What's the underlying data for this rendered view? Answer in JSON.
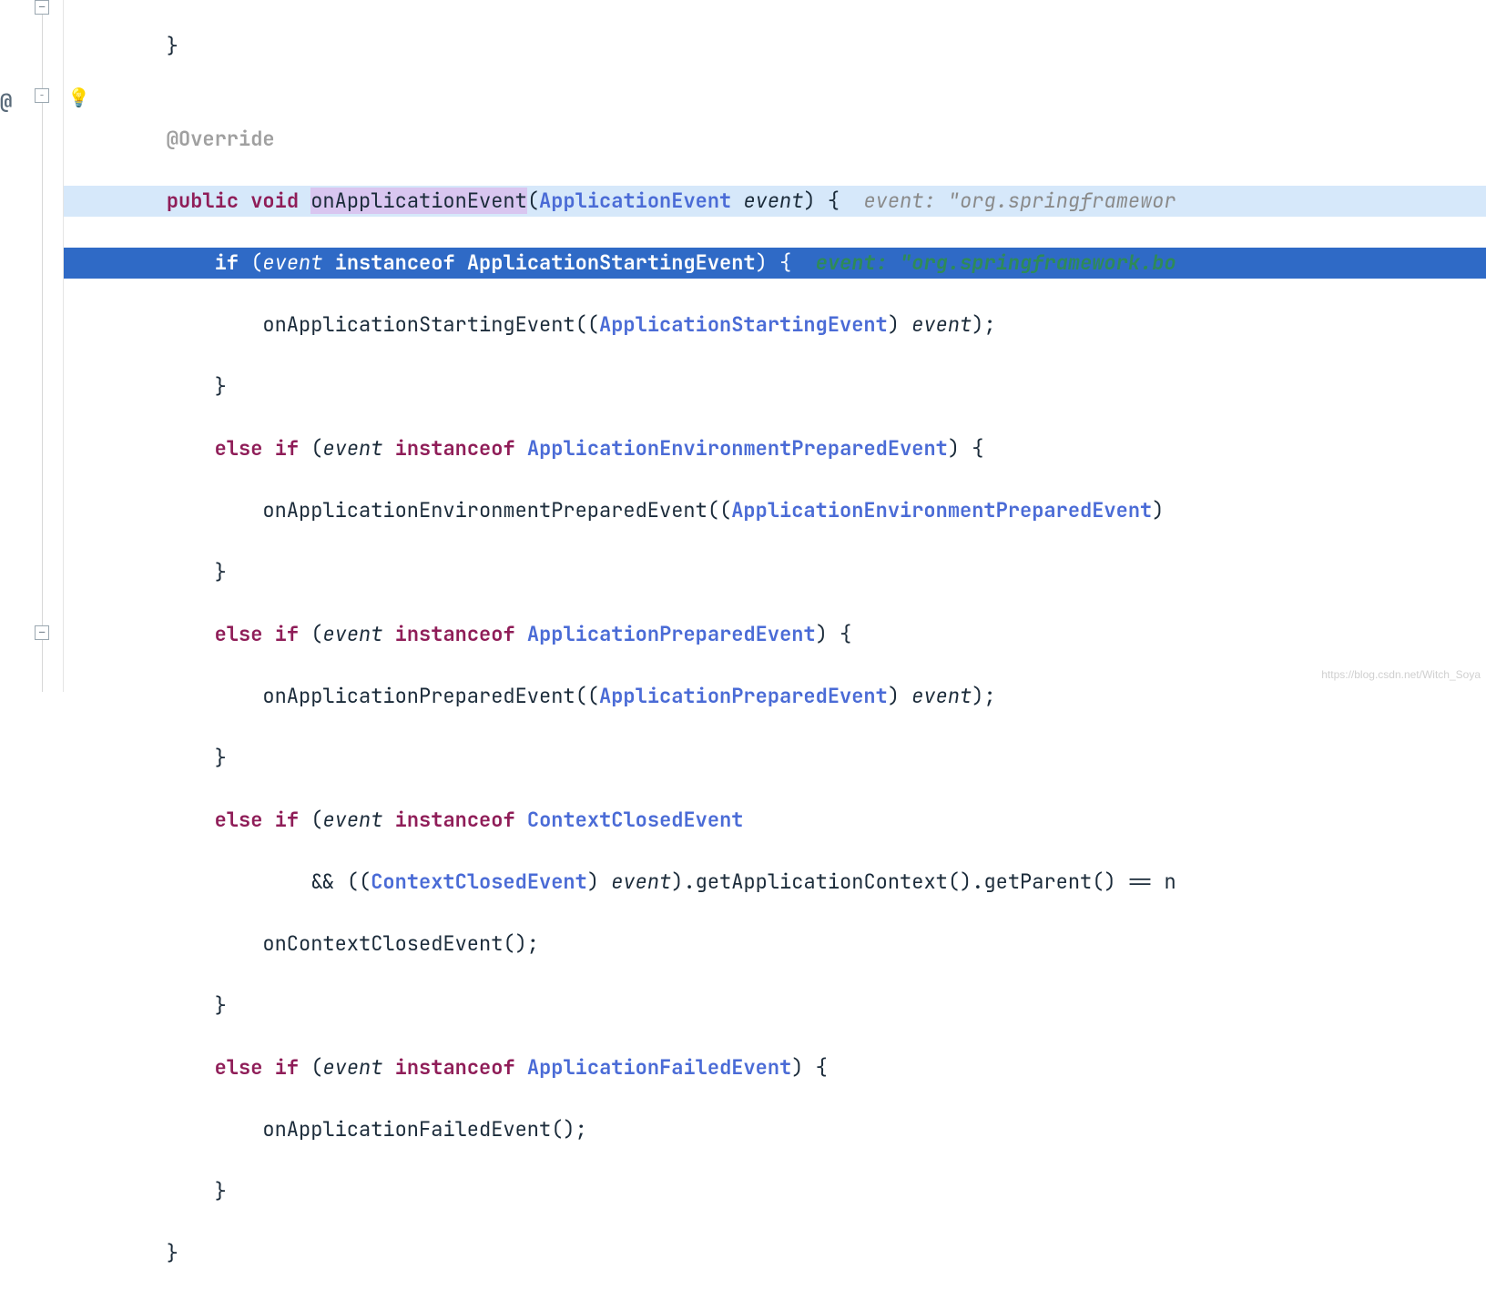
{
  "watermark": "https://blog.csdn.net/Witch_Soya",
  "gutter": {
    "at_marker": "@",
    "bulb": "💡",
    "fold_top_minus": "─",
    "fold_mid_minus": "−",
    "fold_bottom_plus": "─"
  },
  "code": {
    "l01": "    }",
    "l02": "",
    "l03_ann": "    @Override",
    "l04": {
      "pre": "    ",
      "kw1": "public",
      "sp1": " ",
      "kw2": "void",
      "sp2": " ",
      "method": "onApplicationEvent",
      "paren_o": "(",
      "type": "ApplicationEvent",
      "sp3": " ",
      "param": "event",
      "paren_c_brace": ") {  ",
      "inline_param": "event: ",
      "inline_val": "\"org.springframewor"
    },
    "l05": {
      "pre": "        ",
      "kw_if": "if",
      "sp1": " (",
      "id": "event",
      "sp2": " ",
      "kw_inst": "instanceof",
      "sp3": " ",
      "type": "ApplicationStartingEvent",
      "close": ") {  ",
      "inline_param": "event: ",
      "inline_val": "\"org.springframework.bo"
    },
    "l06": {
      "pre": "            ",
      "call": "onApplicationStartingEvent((",
      "type": "ApplicationStartingEvent",
      "after": ") ",
      "id": "event",
      "semi": ");"
    },
    "l07": "        }",
    "l08": {
      "pre": "        ",
      "kw_else": "else",
      "sp0": " ",
      "kw_if": "if",
      "sp1": " (",
      "id": "event",
      "sp2": " ",
      "kw_inst": "instanceof",
      "sp3": " ",
      "type": "ApplicationEnvironmentPreparedEvent",
      "close": ") {"
    },
    "l09": {
      "pre": "            ",
      "call": "onApplicationEnvironmentPreparedEvent((",
      "type": "ApplicationEnvironmentPreparedEvent",
      "after": ") "
    },
    "l10": "        }",
    "l11": {
      "pre": "        ",
      "kw_else": "else",
      "sp0": " ",
      "kw_if": "if",
      "sp1": " (",
      "id": "event",
      "sp2": " ",
      "kw_inst": "instanceof",
      "sp3": " ",
      "type": "ApplicationPreparedEvent",
      "close": ") {"
    },
    "l12": {
      "pre": "            ",
      "call": "onApplicationPreparedEvent((",
      "type": "ApplicationPreparedEvent",
      "after": ") ",
      "id": "event",
      "semi": ");"
    },
    "l13": "        }",
    "l14": {
      "pre": "        ",
      "kw_else": "else",
      "sp0": " ",
      "kw_if": "if",
      "sp1": " (",
      "id": "event",
      "sp2": " ",
      "kw_inst": "instanceof",
      "sp3": " ",
      "type": "ContextClosedEvent"
    },
    "l15": {
      "pre": "                ",
      "ops": "&& ((",
      "type": "ContextClosedEvent",
      "after1": ") ",
      "id": "event",
      "after2": ").getApplicationContext().getParent() == n"
    },
    "l16": "            onContextClosedEvent();",
    "l17": "        }",
    "l18": {
      "pre": "        ",
      "kw_else": "else",
      "sp0": " ",
      "kw_if": "if",
      "sp1": " (",
      "id": "event",
      "sp2": " ",
      "kw_inst": "instanceof",
      "sp3": " ",
      "type": "ApplicationFailedEvent",
      "close": ") {"
    },
    "l19": "            onApplicationFailedEvent();",
    "l20": "        }",
    "l21": "    }"
  }
}
